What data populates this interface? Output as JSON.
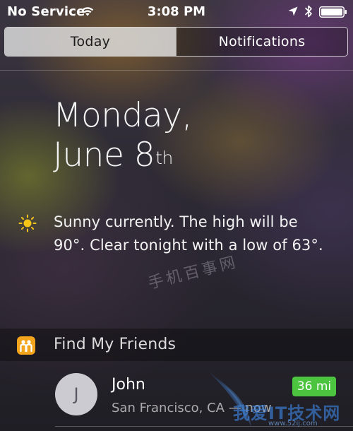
{
  "status_bar": {
    "carrier": "No Service",
    "time": "3:08 PM",
    "icons": [
      "wifi-icon",
      "location-arrow-icon",
      "bluetooth-icon",
      "battery-icon"
    ]
  },
  "tabs": [
    {
      "label": "Today",
      "selected": true
    },
    {
      "label": "Notifications",
      "selected": false
    }
  ],
  "today": {
    "weekday": "Monday,",
    "date_main": "June 8",
    "date_suffix": "th",
    "weather_icon": "sun-icon",
    "weather_text": "Sunny currently. The high will be 90°. Clear tonight with a low of 63°."
  },
  "watermark_top": "手机百事网",
  "find_my_friends": {
    "icon": "find-my-friends-icon",
    "title": "Find My Friends",
    "friends": [
      {
        "initial": "J",
        "name": "John",
        "location": "San Francisco, CA — now",
        "distance": "36 mi"
      }
    ]
  },
  "watermark_bottom": {
    "text": "我爱IT技术网",
    "sub": "www.52ij.com"
  },
  "colors": {
    "accent_green": "#4cc43f",
    "fmf_icon": "#f2a51c",
    "sun": "#f5c518"
  }
}
